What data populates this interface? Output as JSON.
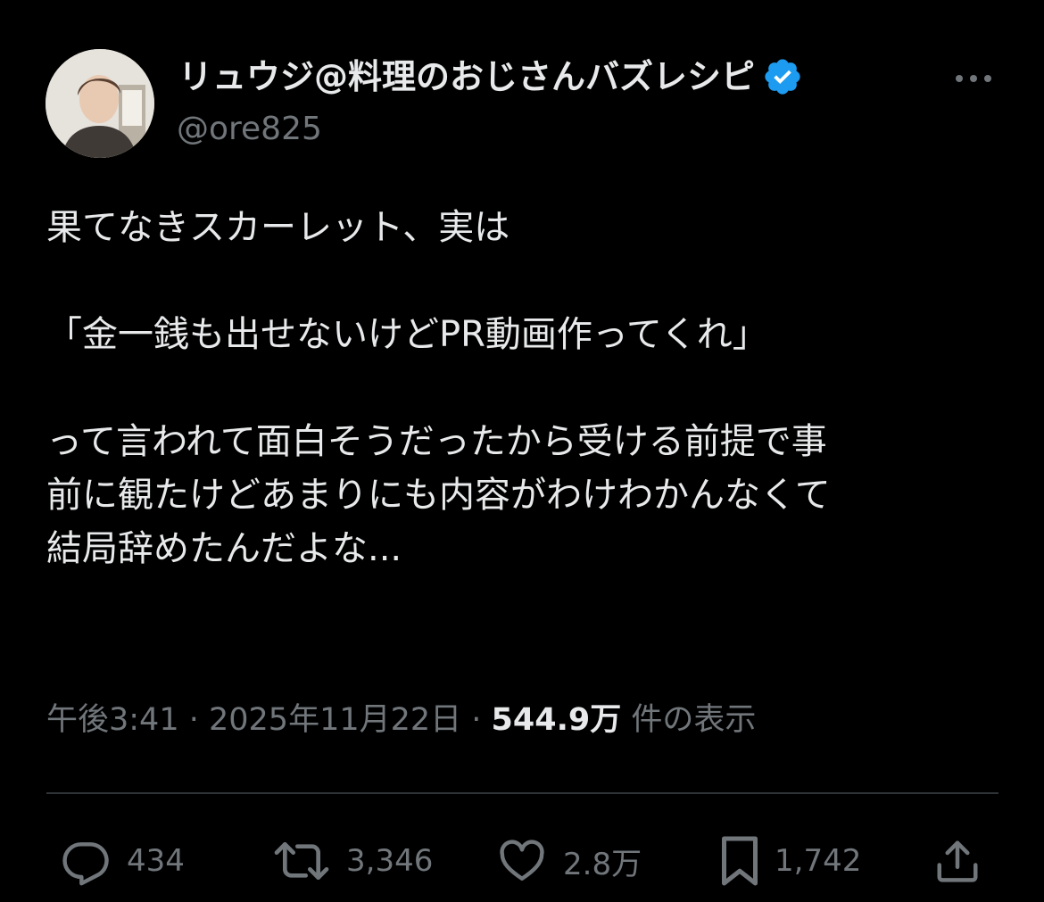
{
  "author": {
    "display_name": "リュウジ@料理のおじさんバズレシピ",
    "handle": "@ore825",
    "verified_icon": "verified-badge-icon",
    "badge_color": "#1d9bf0"
  },
  "tweet": {
    "lines": [
      "果てなきスカーレット、実は",
      "",
      "「金一銭も出せないけどPR動画作ってくれ」",
      "",
      "って言われて面白そうだったから受ける前提で事",
      "前に観たけどあまりにも内容がわけわかんなくて",
      "結局辞めたんだよな..."
    ]
  },
  "meta": {
    "time": "午後3:41",
    "separator": " · ",
    "date": "2025年11月22日",
    "views_count": "544.9万",
    "views_label": " 件の表示"
  },
  "actions": {
    "replies": "434",
    "retweets": "3,346",
    "likes": "2.8万",
    "bookmarks": "1,742"
  },
  "colors": {
    "background": "#000000",
    "text": "#e7e9ea",
    "secondary": "#71767b",
    "divider": "#2f3336"
  }
}
